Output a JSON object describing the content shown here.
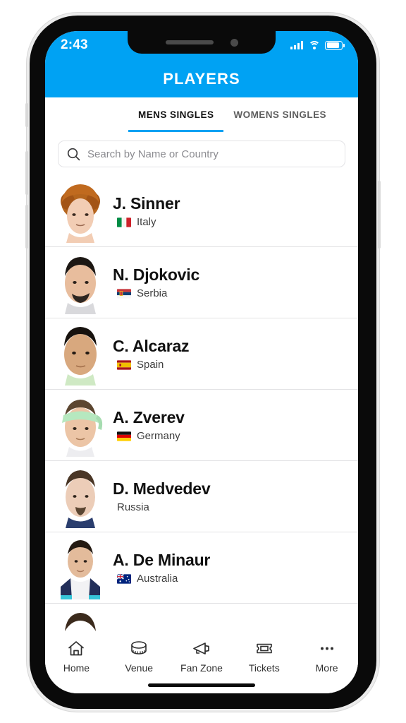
{
  "theme": {
    "accent": "#00A2F3",
    "text_primary": "#111111",
    "text_secondary": "#5e5e5e",
    "divider": "#e2e2e4"
  },
  "status_bar": {
    "time": "2:43",
    "signal_icon": "signal-bars-icon",
    "wifi_icon": "wifi-icon",
    "battery_icon": "battery-icon"
  },
  "header": {
    "title": "PLAYERS"
  },
  "tabs": {
    "items": [
      {
        "label": "MENS SINGLES",
        "active": true
      },
      {
        "label": "WOMENS SINGLES",
        "active": false
      }
    ]
  },
  "search": {
    "placeholder": "Search by Name or Country",
    "value": "",
    "icon": "search-icon"
  },
  "players": [
    {
      "name": "J. Sinner",
      "country": "Italy",
      "flag": "italy-flag",
      "has_flag": true
    },
    {
      "name": "N. Djokovic",
      "country": "Serbia",
      "flag": "serbia-flag",
      "has_flag": true
    },
    {
      "name": "C. Alcaraz",
      "country": "Spain",
      "flag": "spain-flag",
      "has_flag": true
    },
    {
      "name": "A. Zverev",
      "country": "Germany",
      "flag": "germany-flag",
      "has_flag": true
    },
    {
      "name": "D. Medvedev",
      "country": "Russia",
      "flag": "",
      "has_flag": false
    },
    {
      "name": "A. De Minaur",
      "country": "Australia",
      "flag": "australia-flag",
      "has_flag": true
    }
  ],
  "bottom_nav": {
    "items": [
      {
        "label": "Home",
        "icon": "home-icon"
      },
      {
        "label": "Venue",
        "icon": "stadium-icon"
      },
      {
        "label": "Fan Zone",
        "icon": "megaphone-icon"
      },
      {
        "label": "Tickets",
        "icon": "ticket-icon"
      },
      {
        "label": "More",
        "icon": "ellipsis-icon"
      }
    ]
  }
}
